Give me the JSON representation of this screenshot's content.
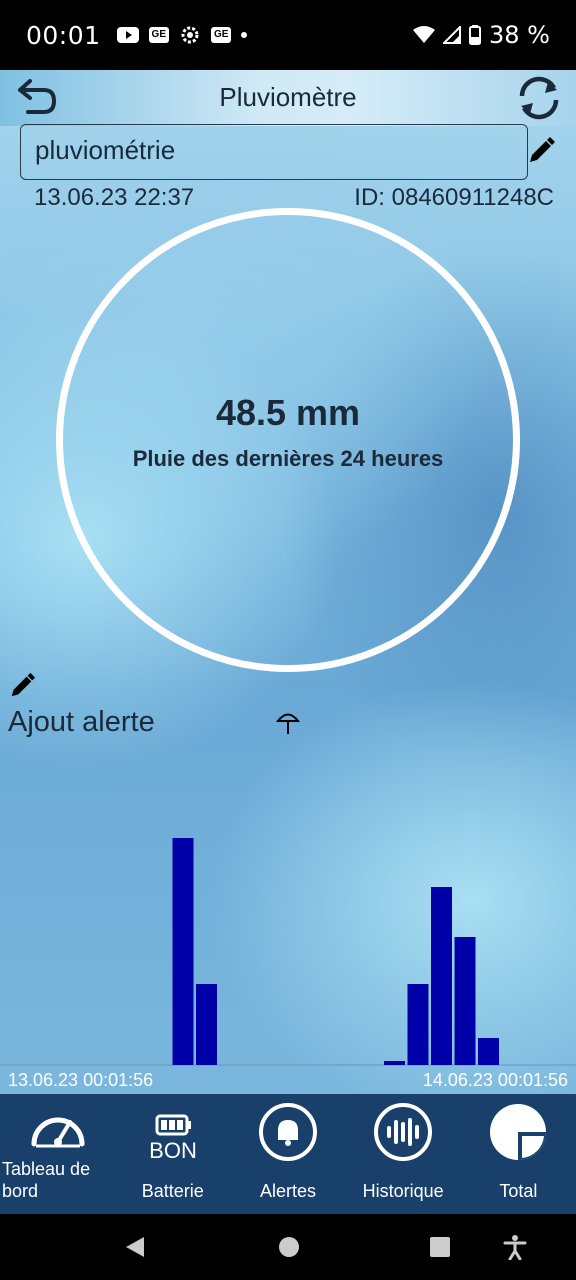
{
  "status_bar": {
    "time": "00:01",
    "battery": "38 %",
    "icons": [
      "youtube-icon",
      "sim-icon",
      "settings-icon",
      "sim-icon",
      "dot-icon",
      "wifi-icon",
      "signal-icon",
      "battery-icon"
    ],
    "sim_badge": "GE"
  },
  "header": {
    "title": "Pluviomètre",
    "back_icon": "back-icon",
    "refresh_icon": "refresh-icon"
  },
  "sensor": {
    "name": "pluviométrie",
    "timestamp": "13.06.23  22:37",
    "device_id": "ID: 08460911248C"
  },
  "gauge": {
    "value": "48.5 mm",
    "label": "Pluie des dernières 24 heures"
  },
  "alert": {
    "label": "Ajout alerte"
  },
  "chart_data": {
    "type": "bar",
    "x_start_label": "13.06.23  00:01:56",
    "x_end_label": "14.06.23  00:01:56",
    "bar_color": "#0000a8",
    "values": [
      0,
      0,
      0,
      0,
      0,
      0,
      0,
      22.7,
      8.1,
      0,
      0,
      0,
      0,
      0,
      0,
      0,
      0.4,
      8.1,
      17.8,
      12.8,
      2.7,
      0,
      0,
      0
    ],
    "ylim": [
      0,
      26
    ]
  },
  "bottom_nav": [
    {
      "label": "Tableau de\nbord",
      "icon": "gauge-icon"
    },
    {
      "label": "Batterie",
      "icon": "battery-icon",
      "badge": "BON"
    },
    {
      "label": "Alertes",
      "icon": "bell-icon"
    },
    {
      "label": "Historique",
      "icon": "history-icon"
    },
    {
      "label": "Total",
      "icon": "pie-icon"
    }
  ],
  "colors": {
    "nav_bg": "#18406a",
    "bar": "#0000a8"
  }
}
